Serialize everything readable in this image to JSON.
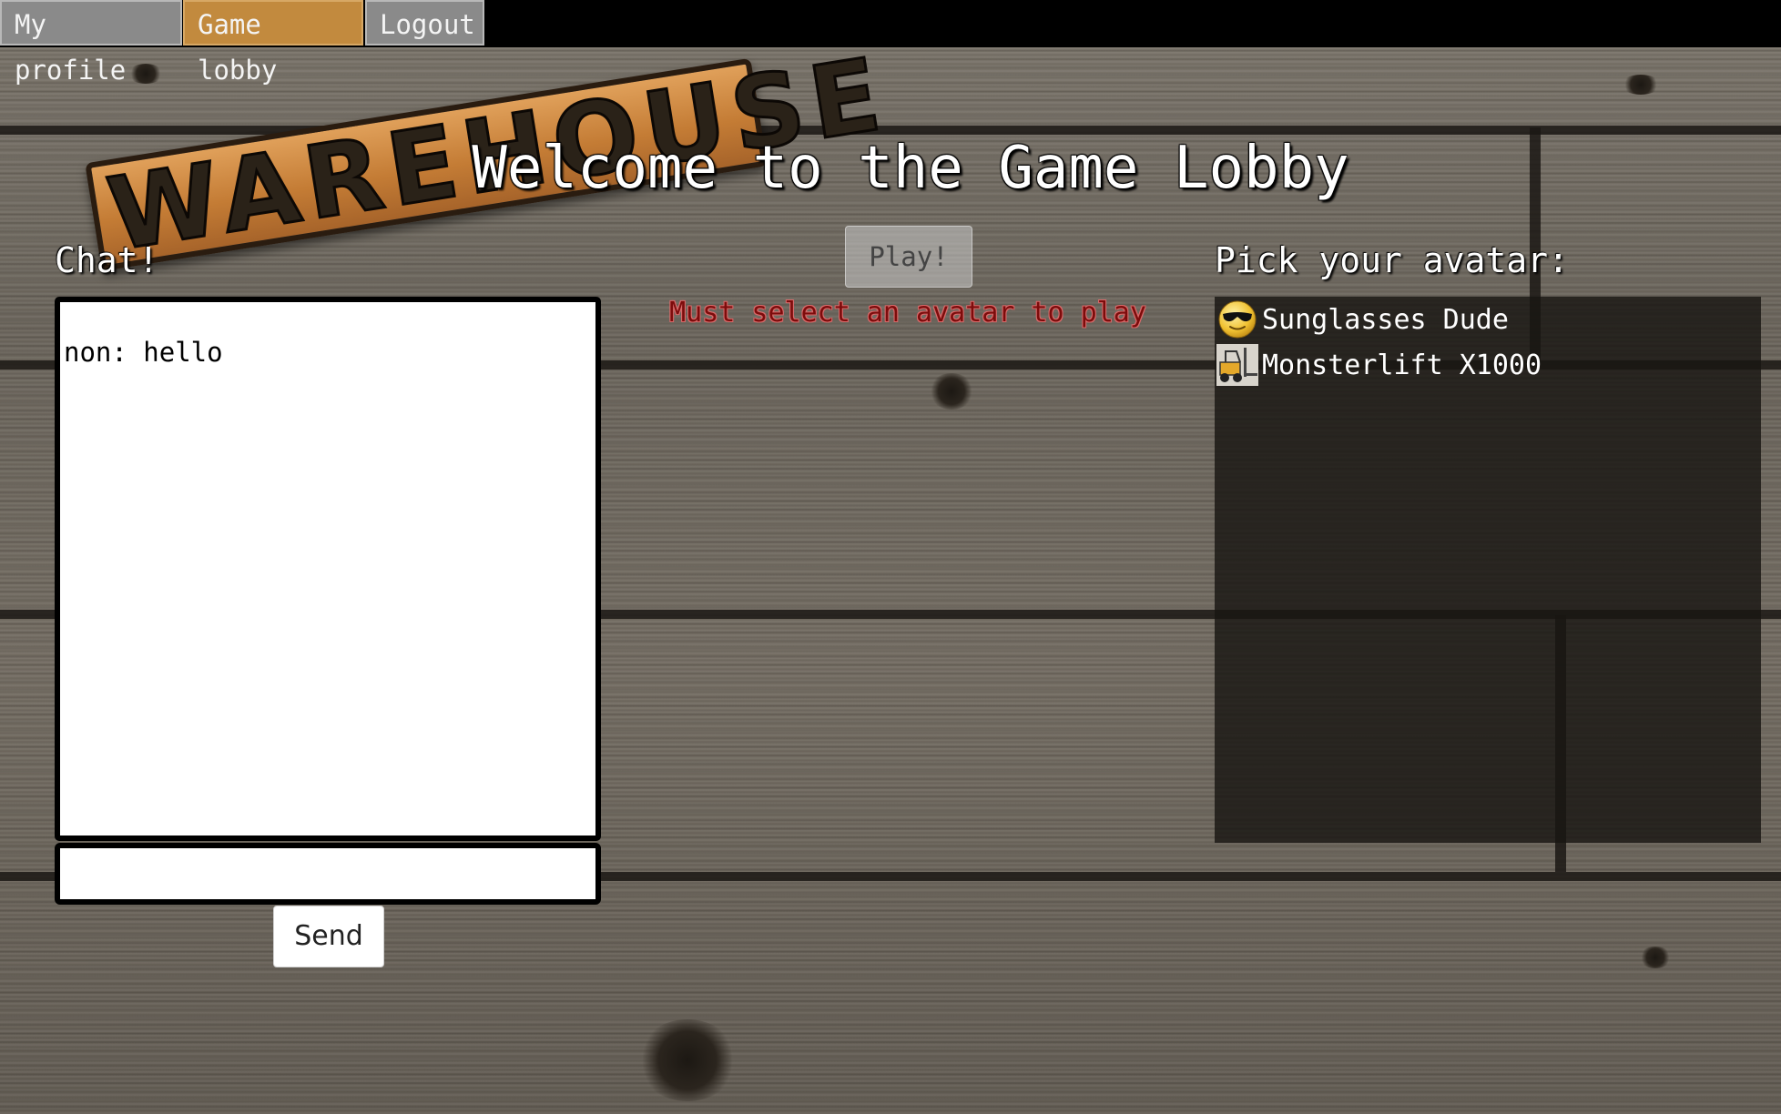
{
  "nav": {
    "items": [
      {
        "label": "My profile",
        "active": false
      },
      {
        "label": "Game lobby",
        "active": true
      },
      {
        "label": "Logout",
        "active": false
      }
    ]
  },
  "logo": {
    "text": "WAREHOUSE"
  },
  "page": {
    "title": "Welcome to the Game Lobby"
  },
  "chat": {
    "heading": "Chat!",
    "messages": [
      {
        "text": "non: hello"
      }
    ],
    "input_value": "",
    "send_label": "Send"
  },
  "play": {
    "button_label": "Play!",
    "disabled": true,
    "warning": "Must select an avatar to play"
  },
  "avatars": {
    "heading": "Pick your avatar:",
    "items": [
      {
        "name": "Sunglasses Dude",
        "icon": "sunglasses-face-icon"
      },
      {
        "name": "Monsterlift X1000",
        "icon": "forklift-icon"
      }
    ]
  },
  "colors": {
    "nav_active": "#c28a3e",
    "nav_inactive": "#8a8a8a",
    "warning_text": "#7d0c0c",
    "avatar_panel": "#191612"
  }
}
